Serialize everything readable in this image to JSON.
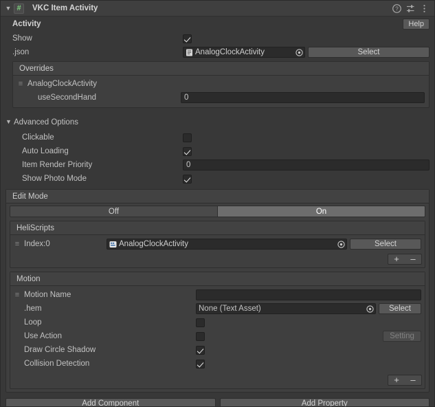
{
  "component": {
    "title": "VKC Item Activity",
    "icon": "cs-script-icon",
    "foldout_expanded": true,
    "header_icons": [
      "help-icon",
      "preset-icon",
      "more-menu-icon"
    ]
  },
  "activity": {
    "section_label": "Activity",
    "help_button": "Help",
    "show": {
      "label": "Show",
      "checked": true
    },
    "json": {
      "label": ".json",
      "value": "AnalogClockActivity",
      "icon": "text-asset-icon",
      "select_button": "Select"
    },
    "overrides": {
      "title": "Overrides",
      "group_name": "AnalogClockActivity",
      "fields": [
        {
          "label": "useSecondHand",
          "value": "0"
        }
      ]
    }
  },
  "advanced_options": {
    "label": "Advanced Options",
    "expanded": true,
    "rows": [
      {
        "label": "Clickable",
        "type": "checkbox",
        "checked": false
      },
      {
        "label": "Auto Loading",
        "type": "checkbox",
        "checked": true
      },
      {
        "label": "Item Render Priority",
        "type": "number",
        "value": "0"
      },
      {
        "label": "Show Photo Mode",
        "type": "checkbox",
        "checked": true
      }
    ]
  },
  "edit_mode": {
    "title": "Edit Mode",
    "options": [
      "Off",
      "On"
    ],
    "selected": "On"
  },
  "heli_scripts": {
    "title": "HeliScripts",
    "items": [
      {
        "index_label": "Index:0",
        "value": "AnalogClockActivity",
        "icon": "cs-script-icon",
        "select_button": "Select"
      }
    ],
    "add_button": "+",
    "remove_button": "–"
  },
  "motion": {
    "title": "Motion",
    "name_row": {
      "label": "Motion Name",
      "value": ""
    },
    "hem_row": {
      "label": ".hem",
      "value": "None (Text Asset)",
      "select_button": "Select"
    },
    "rows": [
      {
        "label": "Loop",
        "type": "checkbox",
        "checked": false
      },
      {
        "label": "Use Action",
        "type": "checkbox",
        "checked": false,
        "extra_button": "Setting",
        "extra_disabled": true
      },
      {
        "label": "Draw Circle Shadow",
        "type": "checkbox",
        "checked": true
      },
      {
        "label": "Collision Detection",
        "type": "checkbox",
        "checked": true
      }
    ],
    "add_button": "+",
    "remove_button": "–"
  },
  "footer": {
    "add_component": "Add Component",
    "add_property": "Add Property"
  },
  "colors": {
    "window_bg": "#383838",
    "header_bg": "#3f3f3f",
    "field_bg": "#2b2b2b",
    "button_bg": "#585858",
    "selected_toggle": "#6d6d6d",
    "text": "#c4c4c4",
    "icon_accent": "#7fd37f"
  }
}
